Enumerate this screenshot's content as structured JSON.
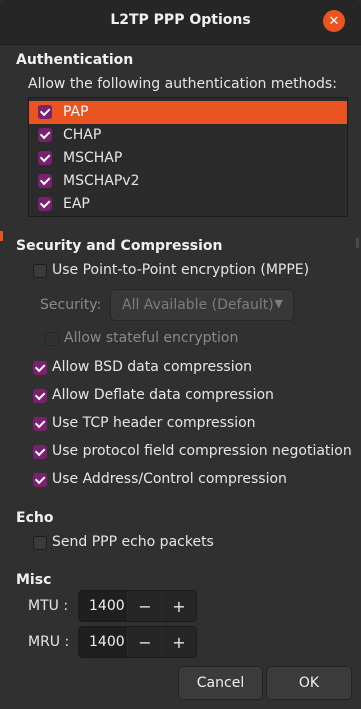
{
  "window": {
    "title": "L2TP PPP Options",
    "close_glyph": "✕"
  },
  "authentication": {
    "section_title": "Authentication",
    "prompt": "Allow the following authentication methods:",
    "methods": [
      {
        "label": "PAP",
        "checked": true,
        "selected": true
      },
      {
        "label": "CHAP",
        "checked": true,
        "selected": false
      },
      {
        "label": "MSCHAP",
        "checked": true,
        "selected": false
      },
      {
        "label": "MSCHAPv2",
        "checked": true,
        "selected": false
      },
      {
        "label": "EAP",
        "checked": true,
        "selected": false
      }
    ]
  },
  "security": {
    "section_title": "Security and Compression",
    "mppe_label": "Use Point-to-Point encryption (MPPE)",
    "mppe_checked": false,
    "security_label": "Security:",
    "security_value": "All Available (Default)",
    "stateful_label": "Allow stateful encryption",
    "bsd_label": "Allow BSD data compression",
    "deflate_label": "Allow Deflate data compression",
    "tcp_label": "Use TCP header compression",
    "protocol_label": "Use protocol field compression negotiation",
    "address_label": "Use Address/Control compression"
  },
  "echo": {
    "section_title": "Echo",
    "send_label": "Send PPP echo packets",
    "send_checked": false
  },
  "misc": {
    "section_title": "Misc",
    "mtu_label": "MTU :",
    "mtu_value": "1400",
    "mru_label": "MRU :",
    "mru_value": "1400",
    "minus_glyph": "−",
    "plus_glyph": "+"
  },
  "buttons": {
    "cancel": "Cancel",
    "ok": "OK"
  },
  "colors": {
    "accent": "#e95420",
    "checkbox": "#77216f"
  },
  "icons": {
    "dropdown_caret": "▼"
  }
}
